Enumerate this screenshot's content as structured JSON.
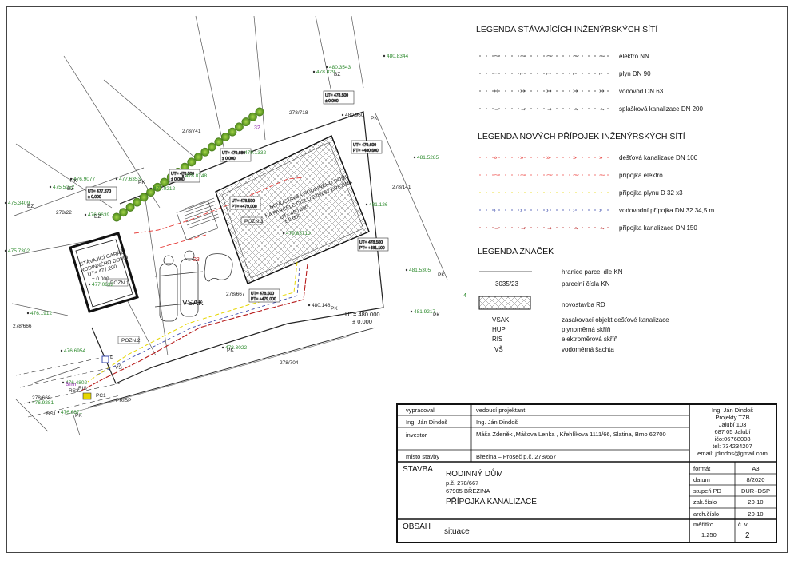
{
  "legend_existing": {
    "title": "LEGENDA STÁVAJÍCÍCH INŽENÝRSKÝCH SÍTÍ",
    "items": [
      {
        "label": "elektro NN",
        "color": "#333333",
        "glyph": "⁓"
      },
      {
        "label": "plyn DN 90",
        "color": "#333333",
        "glyph": "⌐"
      },
      {
        "label": "vodovod DN 63",
        "color": "#333333",
        "glyph": "↣"
      },
      {
        "label": "splašková kanalizace DN 200",
        "color": "#333333",
        "glyph": "→"
      }
    ]
  },
  "legend_new": {
    "title": "LEGENDA NOVÝCH  PŘÍPOJEK INŽENÝRSKÝCH SÍTÍ",
    "items": [
      {
        "label": "dešťová kanalizace DN  100",
        "color": "#e53935",
        "glyph": "»"
      },
      {
        "label": "přípojka elektro",
        "color": "#ef5350",
        "glyph": "⁓"
      },
      {
        "label": "přípojka plynu  D 32 x3",
        "color": "#e6d600",
        "glyph": "-"
      },
      {
        "label": "vodovodní přípojka DN 32   34,5 m",
        "color": "#3949ab",
        "glyph": "›"
      },
      {
        "label": "přípojka kanalizace DN 150",
        "color": "#b71c1c",
        "glyph": "→"
      }
    ]
  },
  "legend_symbols": {
    "title": "LEGENDA ZNAČEK",
    "items": [
      {
        "label": "hranice parcel dle KN"
      },
      {
        "code": "3035/23",
        "label": "parcelní čísla KN"
      },
      {
        "label": "novostavba RD"
      },
      {
        "code": "VSAK",
        "label": "zasakovací objekt dešťové kanalizace"
      },
      {
        "code": "HUP",
        "label": "plynoměrná skříň"
      },
      {
        "code": "RIS",
        "label": "elektroměrová skříň"
      },
      {
        "code": "VŠ",
        "label": "vodoměrná šachta"
      }
    ]
  },
  "plan": {
    "parcels": [
      "278/741",
      "278/718",
      "278/141",
      "278/22",
      "278/667",
      "278/666",
      "278/704",
      "278/668"
    ],
    "elevations": [
      {
        "text": "480.8344",
        "color": "#2e8b2e"
      },
      {
        "text": "478.829",
        "color": "#2e8b2e"
      },
      {
        "text": "480.3543",
        "color": "#2e8b2e"
      },
      {
        "text": "480.960",
        "color": "#222222"
      },
      {
        "text": "481.5285",
        "color": "#2e8b2e"
      },
      {
        "text": "481.126",
        "color": "#2e8b2e"
      },
      {
        "text": "481.5305",
        "color": "#2e8b2e"
      },
      {
        "text": "481.9217",
        "color": "#2e8b2e"
      },
      {
        "text": "479.1332",
        "color": "#2e8b2e"
      },
      {
        "text": "477.6353",
        "color": "#2e8b2e"
      },
      {
        "text": "476.9077",
        "color": "#2e8b2e"
      },
      {
        "text": "475.5052",
        "color": "#2e8b2e"
      },
      {
        "text": "475.3409",
        "color": "#2e8b2e"
      },
      {
        "text": "476.9639",
        "color": "#2e8b2e"
      },
      {
        "text": "477.0212",
        "color": "#2e8b2e"
      },
      {
        "text": "478.8748",
        "color": "#2e8b2e"
      },
      {
        "text": "475.7302",
        "color": "#2e8b2e"
      },
      {
        "text": "477.0632",
        "color": "#2e8b2e"
      },
      {
        "text": "476.1912",
        "color": "#2e8b2e"
      },
      {
        "text": "479.83710",
        "color": "#2e8b2e"
      },
      {
        "text": "478.3022",
        "color": "#2e8b2e"
      },
      {
        "text": "480.148",
        "color": "#222222"
      },
      {
        "text": "476.6954",
        "color": "#2e8b2e"
      },
      {
        "text": "476.4802",
        "color": "#2e8b2e"
      },
      {
        "text": "476.9281",
        "color": "#2e8b2e"
      },
      {
        "text": "476.6871",
        "color": "#2e8b2e"
      }
    ],
    "point_codes": [
      "BZ",
      "PK",
      "PK",
      "BZ",
      "BZ",
      "PK",
      "PK",
      "PK",
      "PK",
      "PK",
      "BZ",
      "PK"
    ],
    "house_label_1": "NOVOSTAVBA RODINNÉHO DOMU",
    "house_label_2": "NA PARCELE ČÍSLO 278/667  BŘEZINA",
    "house_ut": "UT= 480.000",
    "house_pt": "± 0.000",
    "garage_label_1": "STÁVAJÍCÍ GARÁŽ",
    "garage_label_2": "RODINNÉHO DOMU",
    "garage_ut": "UT= 477.200",
    "garage_pt": "± 0.000",
    "vsak_label": "VSAK",
    "pozn_1": "POZN.1",
    "pozn_2": "POZN.2",
    "pozn_3": "POZN.3",
    "main_ut_1": "UT= 480.000",
    "main_ut_2": "± 0.000",
    "tags": [
      "UT= 478.500",
      "UT= 477.370",
      "UT= 479.600",
      "UT= 479.600",
      "UT= 478.500",
      "UT= 478.500",
      "UT= 478.500",
      "UT= 478.500"
    ],
    "tags_pt": [
      "± 0.000",
      "± 0.000",
      "± 0.000",
      "PT= +480.600",
      "PT= +479.000",
      "PT= +479.000",
      "± 0.000",
      "PT= +481.100"
    ],
    "number_23": "23",
    "number_32": "32",
    "number_4": "4",
    "vs": "VŠ",
    "ris": "RIS",
    "hup": "P",
    "prisp": "PRISP",
    "mini_codes": [
      "Bmm",
      "PC1",
      "RS3",
      "BS1"
    ]
  },
  "title_block": {
    "vypracoval_label": "vypracoval",
    "vedouci_label": "vedoucí projektant",
    "vypracoval": "Ing. Ján Dindoš",
    "vedouci": "Ing. Ján Dindoš",
    "investor_label": "investor",
    "investor": "Máša Zdeněk ,Mášova Lenka , Křehlíkova 1111/66, Slatina, Brno 62700",
    "misto_label": "místo stavby",
    "misto": "Březina – Proseč p.č. 278/667",
    "stavba_label": "STAVBA",
    "stavba_line1": "RODINNÝ DŮM",
    "stavba_line2": "p.č. 278/667",
    "stavba_line3": "67905 BŘEZINA",
    "stavba_line4": "PŘÍPOJKA KANALIZACE",
    "obsah_label": "OBSAH",
    "obsah": "situace",
    "company": [
      "Ing. Ján Dindoš",
      "Projekty TZB",
      "Jalubí 103",
      "687 05 Jalubí",
      "ičo:06768008",
      "tel: 734234207",
      "email: jdindos@gmail.com"
    ],
    "fields": [
      {
        "label": "formát",
        "value": "A3"
      },
      {
        "label": "datum",
        "value": "8/2020"
      },
      {
        "label": "stupeň PD",
        "value": "DUR+DSP"
      },
      {
        "label": "zak.číslo",
        "value": "20-10"
      },
      {
        "label": "arch.číslo",
        "value": "20-10"
      }
    ],
    "scale_label": "měřítko",
    "scale": "1:250",
    "sheet_label": "č. v.",
    "sheet_no": "2"
  }
}
